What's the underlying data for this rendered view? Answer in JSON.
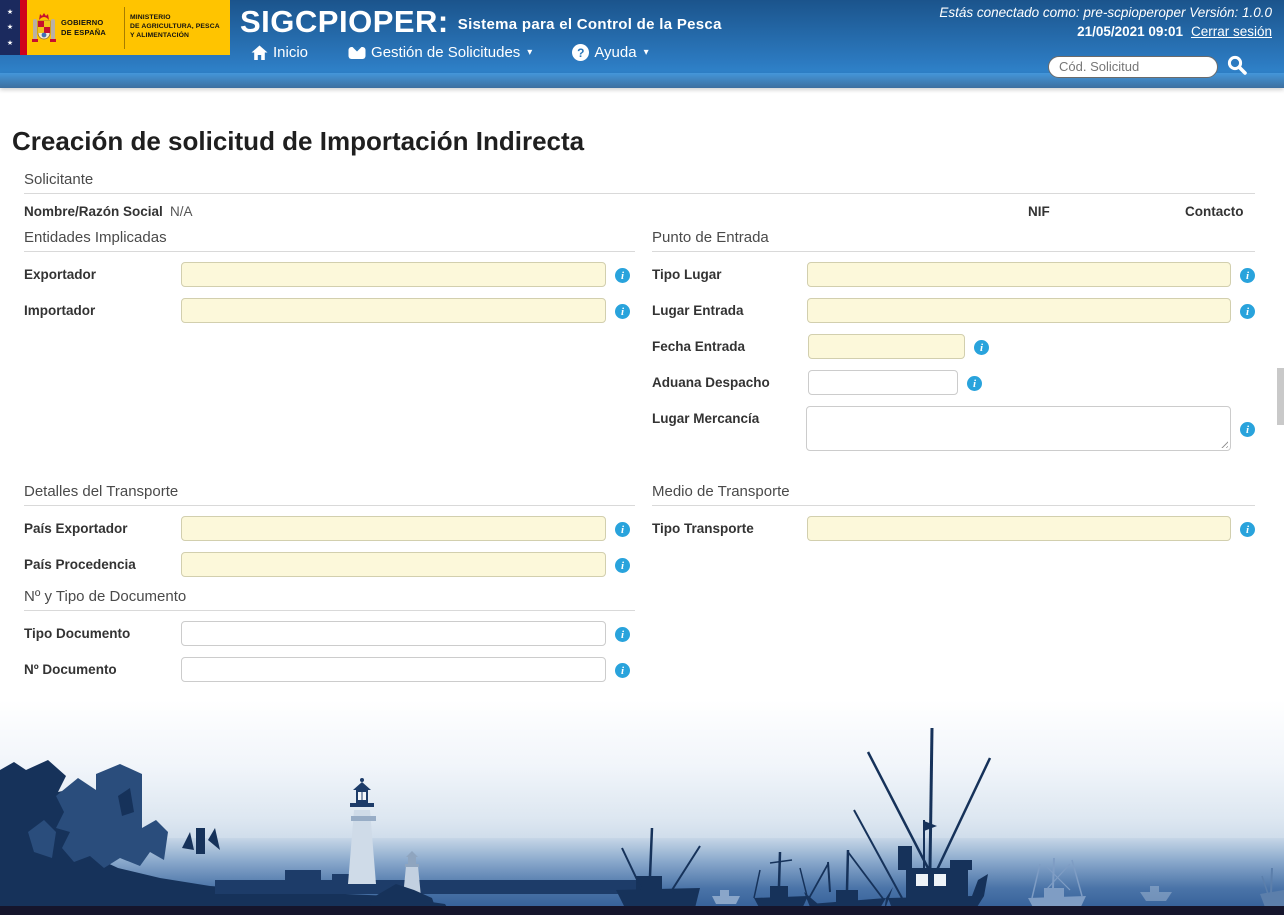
{
  "header": {
    "logo": {
      "government_label": "GOBIERNO\nDE ESPAÑA",
      "ministry_label": "MINISTERIO\nDE AGRICULTURA, PESCA\nY ALIMENTACIÓN"
    },
    "brand_title": "SIGCPIOPER:",
    "brand_subtitle": "Sistema para el Control de la Pesca",
    "session_line": "Estás conectado como: pre-scpioperoper Versión: 1.0.0",
    "session_datetime": "21/05/2021 09:01",
    "logout_label": "Cerrar sesión",
    "nav": {
      "home": "Inicio",
      "solicitudes": "Gestión de Solicitudes",
      "ayuda": "Ayuda"
    },
    "search_placeholder": "Cód. Solicitud"
  },
  "icons": {
    "home": "home-icon",
    "solicitudes": "inbox-icon",
    "ayuda": "help-icon",
    "search": "search-icon",
    "info": "info-icon",
    "caret_glyph": "▾",
    "help_glyph": "?",
    "star_glyph": "★",
    "info_glyph": "i"
  },
  "page": {
    "title": "Creación de solicitud de Importación Indirecta"
  },
  "form": {
    "solicitante": {
      "title": "Solicitante",
      "nombre_label": "Nombre/Razón Social",
      "nombre_value": "N/A",
      "nif_label": "NIF",
      "contacto_label": "Contacto"
    },
    "entidades": {
      "title": "Entidades Implicadas",
      "exportador": {
        "label": "Exportador",
        "value": ""
      },
      "importador": {
        "label": "Importador",
        "value": ""
      }
    },
    "punto_entrada": {
      "title": "Punto de Entrada",
      "tipo_lugar": {
        "label": "Tipo Lugar",
        "value": ""
      },
      "lugar_entrada": {
        "label": "Lugar Entrada",
        "value": ""
      },
      "fecha_entrada": {
        "label": "Fecha Entrada",
        "value": ""
      },
      "aduana_despacho": {
        "label": "Aduana Despacho",
        "value": ""
      },
      "lugar_mercancia": {
        "label": "Lugar Mercancía",
        "value": ""
      }
    },
    "transporte": {
      "title": "Detalles del Transporte",
      "pais_exportador": {
        "label": "País Exportador",
        "value": ""
      },
      "pais_procedencia": {
        "label": "País Procedencia",
        "value": ""
      }
    },
    "documento": {
      "title": "Nº y Tipo de Documento",
      "tipo_documento": {
        "label": "Tipo Documento",
        "value": ""
      },
      "num_documento": {
        "label": "Nº Documento",
        "value": ""
      }
    },
    "medio_transporte": {
      "title": "Medio de Transporte",
      "tipo_transporte": {
        "label": "Tipo Transporte",
        "value": ""
      }
    }
  },
  "colors": {
    "header_blue_top": "#1b548c",
    "header_blue_bottom": "#2f82c9",
    "accent_strip": "#4496da",
    "required_field_bg": "#fcf8da",
    "info_icon_blue": "#29a3dc",
    "logo_yellow": "#ffc400",
    "flag_red": "#d0021b",
    "footer_navy_dark": "#16325a",
    "footer_navy_mid": "#2a4d7c",
    "footer_bottom_strip": "#15152c"
  }
}
